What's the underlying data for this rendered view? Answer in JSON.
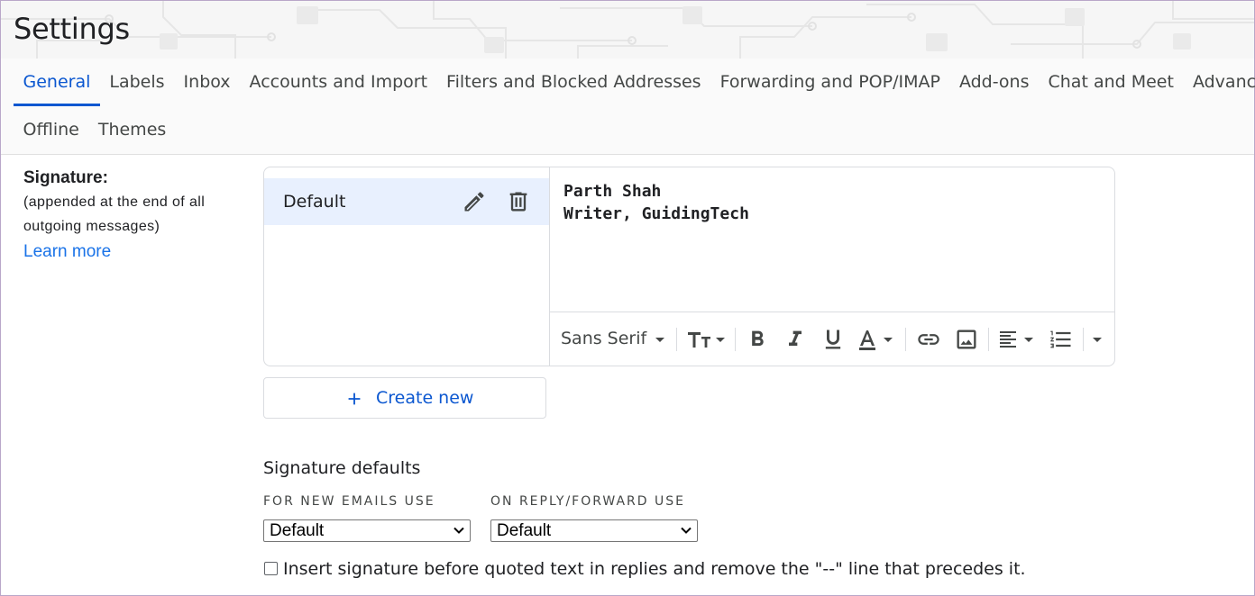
{
  "header": {
    "title": "Settings"
  },
  "tabs": {
    "row1": [
      "General",
      "Labels",
      "Inbox",
      "Accounts and Import",
      "Filters and Blocked Addresses",
      "Forwarding and POP/IMAP",
      "Add-ons",
      "Chat and Meet",
      "Advanced"
    ],
    "row2": [
      "Offline",
      "Themes"
    ],
    "active": "General"
  },
  "signature": {
    "label": "Signature:",
    "sub1": "(appended at the end of all",
    "sub2": "outgoing messages)",
    "learn_more": "Learn more",
    "items": [
      {
        "name": "Default"
      }
    ],
    "editor_lines": [
      "Parth Shah",
      "Writer, GuidingTech"
    ],
    "toolbar": {
      "font": "Sans Serif"
    },
    "create_new": "Create new"
  },
  "defaults": {
    "title": "Signature defaults",
    "new_emails_caption": "FOR NEW EMAILS USE",
    "reply_caption": "ON REPLY/FORWARD USE",
    "new_emails_value": "Default",
    "reply_value": "Default",
    "insert_before_quoted": "Insert signature before quoted text in replies and remove the \"--\" line that precedes it.",
    "insert_checked": false
  },
  "colors": {
    "accent": "#0b57d0",
    "link": "#1a73e8",
    "selected_item": "#e8f0fe"
  }
}
